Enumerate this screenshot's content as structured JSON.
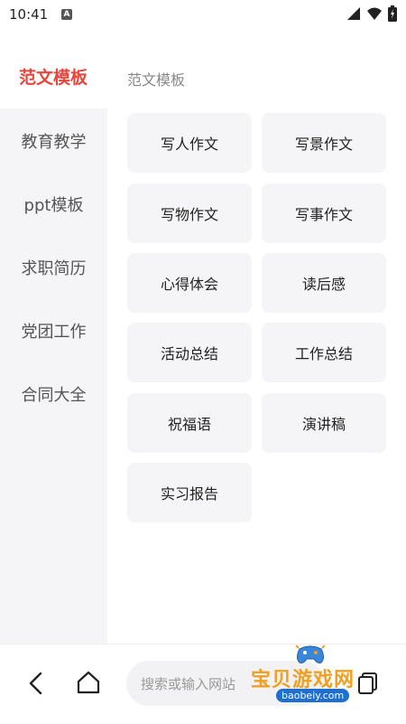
{
  "status_bar": {
    "time": "10:41",
    "app_icon": "A",
    "icons": [
      "wifi-icon",
      "signal-icon",
      "battery-icon"
    ]
  },
  "header": {
    "category_title": "范文模板",
    "subcategory_title": "范文模板"
  },
  "sidebar": {
    "items": [
      {
        "label": "教育教学"
      },
      {
        "label": "ppt模板"
      },
      {
        "label": "求职简历"
      },
      {
        "label": "党团工作"
      },
      {
        "label": "合同大全"
      }
    ]
  },
  "grid": {
    "items": [
      {
        "label": "写人作文"
      },
      {
        "label": "写景作文"
      },
      {
        "label": "写物作文"
      },
      {
        "label": "写事作文"
      },
      {
        "label": "心得体会"
      },
      {
        "label": "读后感"
      },
      {
        "label": "活动总结"
      },
      {
        "label": "工作总结"
      },
      {
        "label": "祝福语"
      },
      {
        "label": "演讲稿"
      },
      {
        "label": "实习报告"
      }
    ]
  },
  "bottom_bar": {
    "search_placeholder": "搜索或输入网站",
    "icons": [
      "back-icon",
      "home-icon",
      "tabs-icon"
    ]
  },
  "watermark": {
    "main": "宝贝游戏网",
    "sub": "baobeiy.com"
  },
  "colors": {
    "accent": "#e8453c",
    "sidebar_bg": "#f5f5f7",
    "tile_bg": "#f5f5f7",
    "muted_text": "#888888"
  }
}
